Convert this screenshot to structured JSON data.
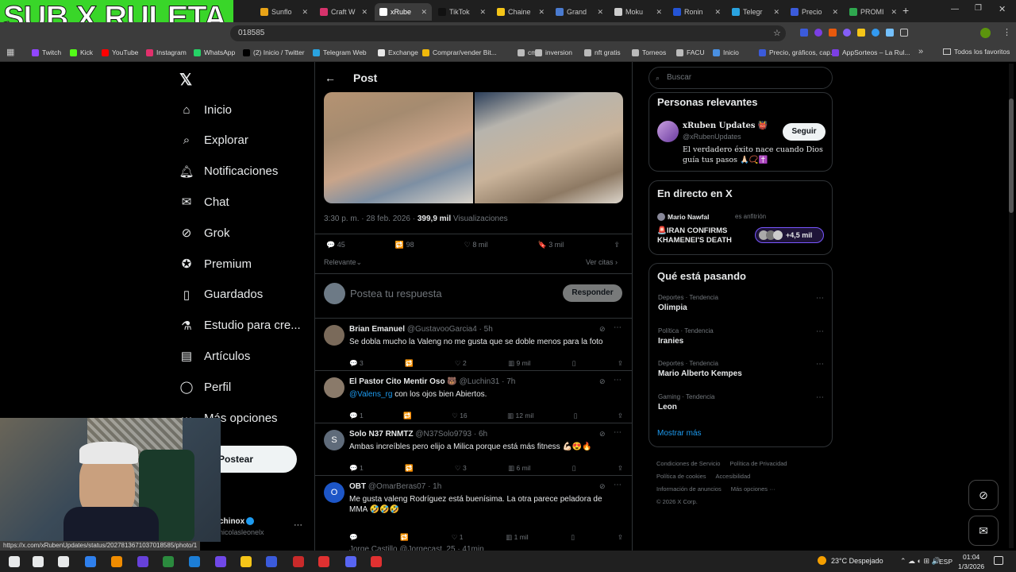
{
  "overlay": {
    "text": "SUB X RULETA"
  },
  "browser": {
    "tabs": [
      {
        "label": "Sunflo",
        "color": "#e8a317",
        "active": false
      },
      {
        "label": "Craft W",
        "color": "#d6336c",
        "active": false
      },
      {
        "label": "xRube",
        "color": "#ffffff",
        "active": true
      },
      {
        "label": "TikTok",
        "color": "#111111",
        "active": false
      },
      {
        "label": "Chaine",
        "color": "#f5c518",
        "active": false
      },
      {
        "label": "Grand",
        "color": "#4a7bd0",
        "active": false
      },
      {
        "label": "Moku",
        "color": "#cccccc",
        "active": false
      },
      {
        "label": "Ronin",
        "color": "#2454d6",
        "active": false
      },
      {
        "label": "Telegr",
        "color": "#2aa3e0",
        "active": false
      },
      {
        "label": "Precio",
        "color": "#3b5bdb",
        "active": false
      },
      {
        "label": "PROMI",
        "color": "#2fa84f",
        "active": false
      }
    ],
    "new_tab": "+",
    "url_tail": "018585",
    "bookmarks": [
      {
        "label": "Twitch",
        "color": "#9146ff"
      },
      {
        "label": "Kick",
        "color": "#53fc18"
      },
      {
        "label": "YouTube",
        "color": "#ff0000"
      },
      {
        "label": "Instagram",
        "color": "#e1306c"
      },
      {
        "label": "WhatsApp",
        "color": "#25d366"
      },
      {
        "label": "(2) Inicio / Twitter",
        "color": "#000000"
      },
      {
        "label": "Telegram Web",
        "color": "#2aa3e0"
      },
      {
        "label": "Exchange",
        "color": "#e8e8e8"
      },
      {
        "label": "Comprar/vender Bit...",
        "color": "#f0b90b"
      },
      {
        "label": "cm",
        "color": "#bbbbbb"
      },
      {
        "label": "inversion",
        "color": "#bbbbbb"
      },
      {
        "label": "nft gratis",
        "color": "#bbbbbb"
      },
      {
        "label": "Torneos",
        "color": "#bbbbbb"
      },
      {
        "label": "FACU",
        "color": "#bbbbbb"
      },
      {
        "label": "Inicio",
        "color": "#4a90e2"
      },
      {
        "label": "Precio, gráficos, cap...",
        "color": "#3b5bdb"
      },
      {
        "label": "AppSorteos – La Rul...",
        "color": "#7b3fe4"
      }
    ],
    "bookmarks_more": "»",
    "favorites": "Todos los favoritos",
    "status_url": "https://x.com/xRubenUpdates/status/2027813671037018585/photo/1"
  },
  "nav": [
    {
      "label": "Inicio",
      "icon": "home-icon"
    },
    {
      "label": "Explorar",
      "icon": "search-icon"
    },
    {
      "label": "Notificaciones",
      "icon": "bell-icon"
    },
    {
      "label": "Chat",
      "icon": "mail-icon"
    },
    {
      "label": "Grok",
      "icon": "grok-icon"
    },
    {
      "label": "Premium",
      "icon": "verified-icon"
    },
    {
      "label": "Guardados",
      "icon": "bookmark-icon"
    },
    {
      "label": "Estudio para cre...",
      "icon": "flask-icon"
    },
    {
      "label": "Artículos",
      "icon": "article-icon"
    },
    {
      "label": "Perfil",
      "icon": "person-icon"
    },
    {
      "label": "Más opciones",
      "icon": "more-icon"
    }
  ],
  "post_button": "Postear",
  "account": {
    "name": "chinox",
    "handle": "nicolasleonelx",
    "more": "···"
  },
  "post": {
    "header": "Post",
    "time": "3:30 p. m. · 28 feb. 2026 ·",
    "views": "399,9 mil",
    "views_label": "Visualizaciones",
    "replies": "45",
    "reposts": "98",
    "likes": "8 mil",
    "bookmarks": "3 mil",
    "sort": "Relevante",
    "quotes": "Ver citas",
    "reply_placeholder": "Postea tu respuesta",
    "reply_button": "Responder"
  },
  "replies": [
    {
      "name": "Brian Emanuel",
      "handle": "@GustavooGarcia4 · 5h",
      "text": "Se dobla mucho la Valeng no me gusta que se doble menos para la foto",
      "r": "3",
      "rt": "",
      "l": "2",
      "v": "9 mil",
      "av": "#7a6a5a"
    },
    {
      "name": "El Pastor Cito Mentir Oso 🐻",
      "handle": "@Luchin31 · 7h",
      "text": "con los ojos bien Abiertos.",
      "mention": "@Valens_rg",
      "r": "1",
      "rt": "",
      "l": "16",
      "v": "12 mil",
      "av": "#8a7a6a"
    },
    {
      "name": "Solo N37 RNMTZ",
      "handle": "@N37Solo9793 · 6h",
      "text": "Ambas increíbles pero elijo a Milica porque está más fitness 💪🏻😍🔥",
      "r": "1",
      "rt": "",
      "l": "3",
      "v": "6 mil",
      "av": "#5f6b7a",
      "initial": "S"
    },
    {
      "name": "OBT",
      "handle": "@OmarBeras07 · 1h",
      "text": "Me gusta valeng Rodríguez está buenísima. La otra parece peladora de MMA 🤣🤣🤣",
      "r": "",
      "rt": "",
      "l": "1",
      "v": "1 mil",
      "av": "#1d56c7",
      "initial": "O"
    }
  ],
  "last_reply_peek": "Jorge Castillo @Jorgecast_25 · 41min",
  "search_placeholder": "Buscar",
  "relevant": {
    "title": "Personas relevantes",
    "name": "xRuben Updates 👹",
    "handle": "@xRubenUpdates",
    "bio": "El verdadero éxito nace cuando Dios guía tus pasos 🙏🏻📿✝️",
    "follow": "Seguir"
  },
  "live": {
    "title": "En directo en X",
    "host": "Mario Nawfal",
    "host_tag": "es anfitrión",
    "headline": "🚨IRAN CONFIRMS KHAMENEI'S DEATH",
    "listeners": "+4,5 mil"
  },
  "trends": {
    "title": "Qué está pasando",
    "items": [
      {
        "cat": "Deportes · Tendencia",
        "topic": "Olimpia"
      },
      {
        "cat": "Política · Tendencia",
        "topic": "Iranies"
      },
      {
        "cat": "Deportes · Tendencia",
        "topic": "Mario Alberto Kempes"
      },
      {
        "cat": "Gaming · Tendencia",
        "topic": "Leon"
      }
    ],
    "more": "Mostrar más"
  },
  "footer": [
    "Condiciones de Servicio",
    "Política de Privacidad",
    "Política de cookies",
    "Accesibilidad",
    "Información de anuncios",
    "Más opciones ···",
    "© 2026 X Corp."
  ],
  "taskbar": {
    "weather": "23°C  Despejado",
    "lang": "ESP",
    "time": "01:04",
    "date": "1/3/2026"
  }
}
